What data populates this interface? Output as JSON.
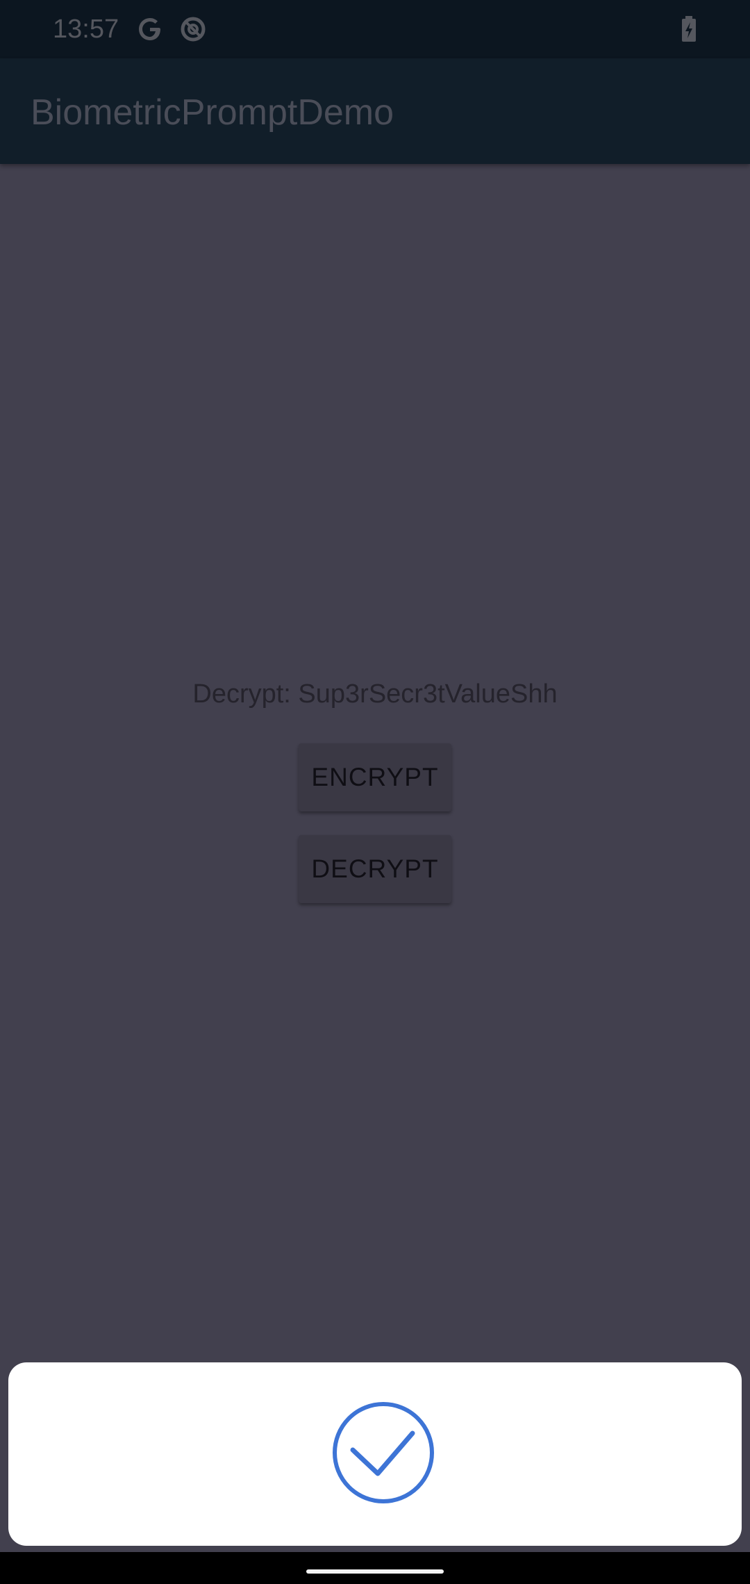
{
  "status_bar": {
    "time": "13:57",
    "icons": [
      "google-icon",
      "data-saver-icon",
      "battery-charging-icon"
    ]
  },
  "app_bar": {
    "title": "BiometricPromptDemo"
  },
  "main": {
    "result_text": "Decrypt: Sup3rSecr3tValueShh",
    "encrypt_label": "ENCRYPT",
    "decrypt_label": "DECRYPT"
  },
  "biometric_sheet": {
    "icon": "checkmark-circle-icon",
    "accent_color": "#3d74d6"
  },
  "colors": {
    "scrim_background": "#42404e",
    "app_bar": "#111e29",
    "status_bar": "#0c1620"
  }
}
